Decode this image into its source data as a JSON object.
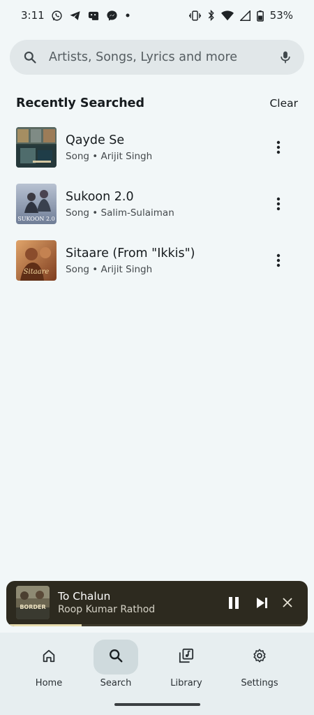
{
  "status_bar": {
    "time": "3:11",
    "notification_icons": [
      "whatsapp-icon",
      "telegram-icon",
      "discord-icon",
      "messenger-icon",
      "dot-icon"
    ],
    "system_icons": [
      "vibrate-icon",
      "bluetooth-icon",
      "wifi-icon",
      "cell-signal-icon",
      "battery-icon"
    ],
    "battery": "53%"
  },
  "search": {
    "placeholder": "Artists, Songs, Lyrics and more",
    "search_icon": "search-icon",
    "mic_icon": "mic-icon"
  },
  "recent": {
    "title": "Recently Searched",
    "clear_label": "Clear",
    "items": [
      {
        "title": "Qayde Se",
        "subtitle": "Song • Arijit Singh"
      },
      {
        "title": "Sukoon 2.0",
        "subtitle": "Song • Salim-Sulaiman",
        "art_text": "SUKOON 2.0"
      },
      {
        "title": "Sitaare (From \"Ikkis\")",
        "subtitle": "Song • Arijit Singh",
        "art_text": "Sitaare"
      }
    ]
  },
  "mini_player": {
    "title": "To Chalun",
    "artist": "Roop Kumar Rathod",
    "art_text": "BORDER",
    "progress": 0.25,
    "controls": [
      "pause-icon",
      "skip-next-icon",
      "close-icon"
    ]
  },
  "nav": {
    "items": [
      {
        "label": "Home",
        "icon": "home-icon"
      },
      {
        "label": "Search",
        "icon": "search-icon",
        "active": true
      },
      {
        "label": "Library",
        "icon": "library-icon"
      },
      {
        "label": "Settings",
        "icon": "settings-icon"
      }
    ]
  },
  "colors": {
    "background": "#f2f7f8",
    "search_field": "#e1e7e9",
    "mini_player": "#2d2a1f",
    "nav_background": "#e7eef0",
    "nav_active_pill": "#cfdadd",
    "progress": "#e7dcae"
  }
}
